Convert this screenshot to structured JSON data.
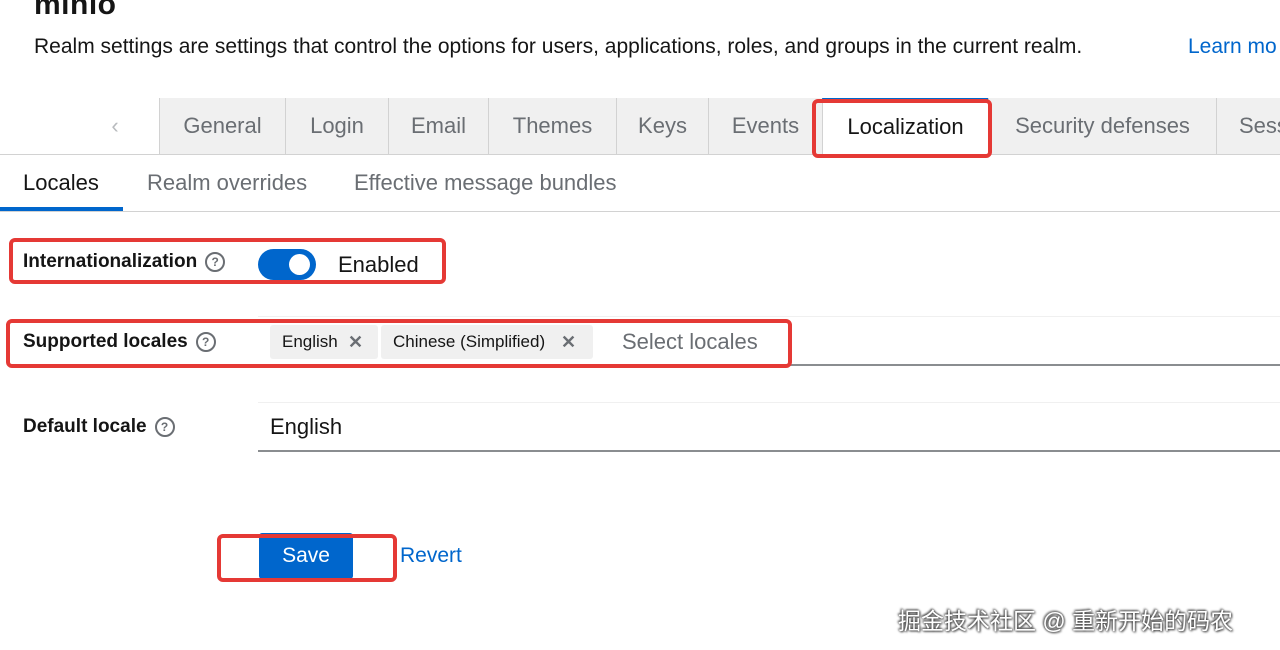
{
  "header": {
    "realm_name": "minio",
    "description": "Realm settings are settings that control the options for users, applications, roles, and groups in the current realm.",
    "learn_more": "Learn mo"
  },
  "main_tabs": {
    "scroll_left_icon": "chevron-left-icon",
    "items": [
      {
        "label": "General"
      },
      {
        "label": "Login"
      },
      {
        "label": "Email"
      },
      {
        "label": "Themes"
      },
      {
        "label": "Keys"
      },
      {
        "label": "Events"
      },
      {
        "label": "Localization",
        "active": true
      },
      {
        "label": "Security defenses"
      },
      {
        "label": "Sess"
      }
    ]
  },
  "sub_tabs": {
    "items": [
      {
        "label": "Locales",
        "active": true
      },
      {
        "label": "Realm overrides"
      },
      {
        "label": "Effective message bundles"
      }
    ]
  },
  "form": {
    "internationalization": {
      "label": "Internationalization",
      "help": "?",
      "enabled": true,
      "state_text": "Enabled"
    },
    "supported_locales": {
      "label": "Supported locales",
      "help": "?",
      "chips": [
        {
          "label": "English",
          "remove": "✕"
        },
        {
          "label": "Chinese (Simplified)",
          "remove": "✕"
        }
      ],
      "placeholder": "Select locales"
    },
    "default_locale": {
      "label": "Default locale",
      "help": "?",
      "value": "English"
    }
  },
  "actions": {
    "save": "Save",
    "revert": "Revert"
  },
  "watermark": "掘金技术社区 @ 重新开始的码农",
  "colors": {
    "accent": "#0066cc",
    "annotation": "#e53935",
    "tab_bg": "#f0f0f0"
  }
}
